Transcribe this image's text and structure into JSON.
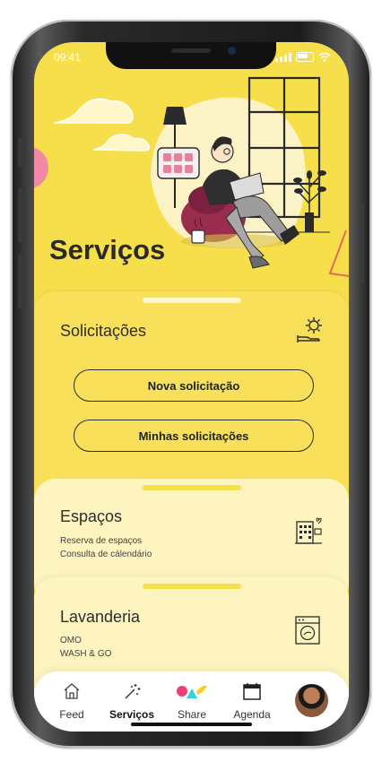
{
  "status": {
    "time": "09:41"
  },
  "header": {
    "title": "Serviços"
  },
  "cards": {
    "solicitacoes": {
      "title": "Solicitações",
      "icon": "gear-hand-icon",
      "buttons": [
        "Nova solicitação",
        "Minhas solicitações"
      ]
    },
    "espacos": {
      "title": "Espaços",
      "lines": [
        "Reserva de espaços",
        "Consulta de cálendário"
      ],
      "icon": "building-icon"
    },
    "lavanderia": {
      "title": "Lavanderia",
      "lines": [
        "OMO",
        "WASH & GO"
      ],
      "icon": "washing-machine-icon"
    }
  },
  "tabbar": {
    "items": [
      {
        "label": "Feed",
        "icon": "home-icon"
      },
      {
        "label": "Serviços",
        "icon": "magic-wand-icon",
        "active": true
      },
      {
        "label": "Share",
        "icon": "shapes-icon"
      },
      {
        "label": "Agenda",
        "icon": "calendar-icon"
      }
    ]
  },
  "colors": {
    "accent": "#f7df4c",
    "card_light": "#fdf4bf",
    "text": "#2d2d2d"
  }
}
